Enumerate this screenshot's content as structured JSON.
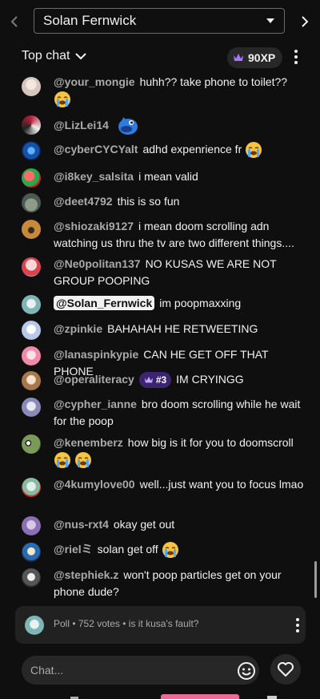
{
  "top_bar": {
    "channel": "Solan Fernwick",
    "prev_icon": "chevron-left-icon",
    "next_icon": "chevron-right-icon"
  },
  "header": {
    "mode": "Top chat",
    "xp": "90XP",
    "xp_color": "#a875ff"
  },
  "messages": [
    {
      "author": "@your_mongie",
      "text": "huhh?? take phone to toilet??",
      "emoji": [
        "loudly-crying-face"
      ]
    },
    {
      "author": "@LizLei14",
      "text": "",
      "emoji": [
        "blue-dragon-sticker"
      ]
    },
    {
      "author": "@cyberCYCYalt",
      "text": "adhd expenrience fr",
      "emoji": [
        "loudly-crying-face"
      ]
    },
    {
      "author": "@i8key_salsita",
      "text": "i mean valid",
      "emoji": []
    },
    {
      "author": "@deet4792",
      "text": "this is so fun",
      "emoji": []
    },
    {
      "author": "@shiozaki9127",
      "text": "i mean doom scrolling adn watching us thru the tv are two different things....",
      "emoji": []
    },
    {
      "author": "@Ne0politan137",
      "text": "NO KUSAS WE ARE NOT GROUP POOPING",
      "emoji": []
    },
    {
      "author": "@Solan_Fernwick",
      "text": "im poopmaxxing",
      "emoji": [],
      "is_owner": true
    },
    {
      "author": "@zpinkie",
      "text": "BAHAHAH HE RETWEETING",
      "emoji": []
    },
    {
      "author": "@lanaspinkypie",
      "text": "CAN HE GET OFF THAT PHONE",
      "emoji": []
    },
    {
      "author": "@operaliteracy",
      "text": "IM CRYINGG",
      "emoji": [],
      "rank": "#3"
    },
    {
      "author": "@cypher_ianne",
      "text": "bro doom scrolling while he wait for the poop",
      "emoji": []
    },
    {
      "author": "@kenemberz",
      "text": "how big is it for you to doomscroll",
      "emoji": [
        "loudly-crying-face",
        "loudly-crying-face"
      ]
    },
    {
      "author": "@4kumylove00",
      "text": "well...just want you to focus lmao",
      "emoji": []
    },
    {
      "author": "@nus-rxt4",
      "text": "okay get out",
      "emoji": []
    },
    {
      "author": "@rielミ",
      "text": "solan get off",
      "emoji": [
        "loudly-crying-face"
      ]
    },
    {
      "author": "@stephiek.z",
      "text": "won't poop particles get on your phone dude?",
      "emoji": []
    }
  ],
  "poll": {
    "text": "Poll • 752 votes • is it kusa's fault?"
  },
  "input": {
    "placeholder": "Chat..."
  }
}
